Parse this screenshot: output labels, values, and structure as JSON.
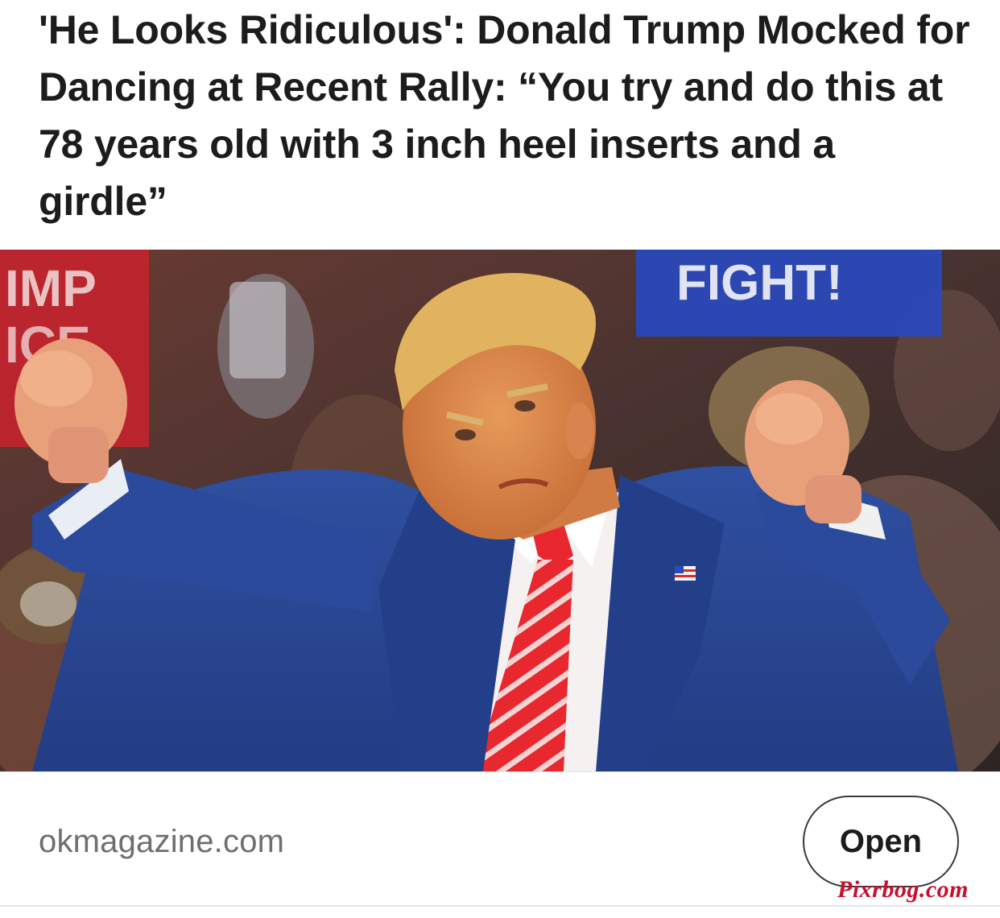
{
  "article": {
    "headline": "'He Looks Ridiculous': Donald Trump Mocked for Dancing at Recent Rally: “You try and do this at 78 years old with 3 inch heel inserts and a girdle”",
    "image": {
      "sign_left_text": "IMP ICE",
      "sign_right_text": "FIGHT!"
    }
  },
  "footer": {
    "source": "okmagazine.com",
    "open_label": "Open",
    "watermark": "Pixrbog.com"
  }
}
